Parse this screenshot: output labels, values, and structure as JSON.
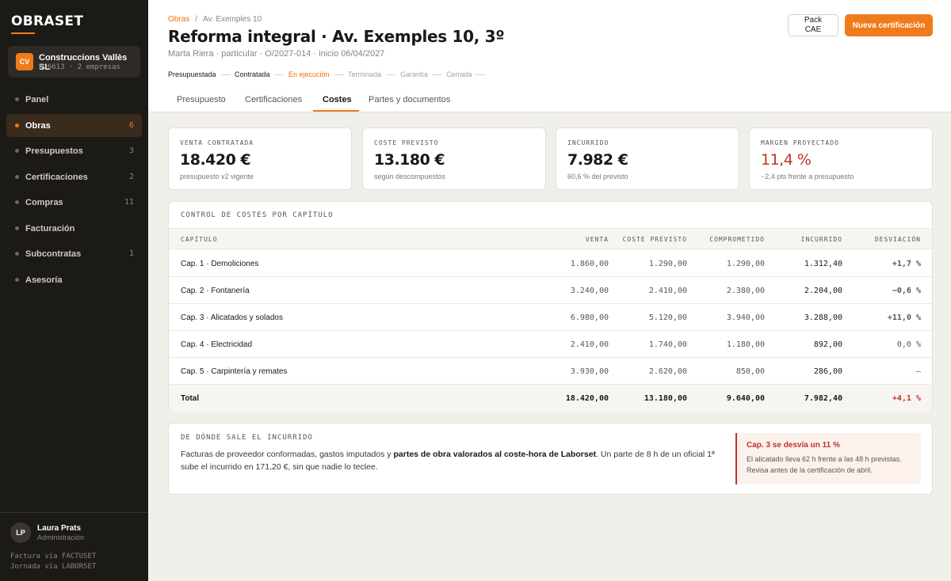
{
  "brand": {
    "logo": "OBRASET",
    "accent": "#f07b1a"
  },
  "company": {
    "initials": "CV",
    "name": "Construccions Vallès SL",
    "sub": "B-6613 · 2 empresas"
  },
  "nav": [
    {
      "label": "Panel",
      "count": ""
    },
    {
      "label": "Obras",
      "count": "6"
    },
    {
      "label": "Presupuestos",
      "count": "3"
    },
    {
      "label": "Certificaciones",
      "count": "2"
    },
    {
      "label": "Compras",
      "count": "11"
    },
    {
      "label": "Facturación",
      "count": ""
    },
    {
      "label": "Subcontratas",
      "count": "1"
    },
    {
      "label": "Asesoría",
      "count": ""
    }
  ],
  "user": {
    "initials": "LP",
    "name": "Laura Prats",
    "role": "Administración",
    "footer1": "Factura vía FACTUSET",
    "footer2": "Jornada vía LABORSET"
  },
  "breadcrumb": {
    "root": "Obras",
    "current": "Av. Exemples 10"
  },
  "project": {
    "title": "Reforma integral · Av. Exemples 10, 3º",
    "meta": "Marta Riera · particular · O/2027-014 · inicio 06/04/2027"
  },
  "actions": {
    "pack_line1": "Pack",
    "pack_line2": "CAE",
    "new_cert": "Nueva certificación"
  },
  "stages": [
    "Presupuestada",
    "Contratada",
    "En ejecución",
    "Terminada",
    "Garantía",
    "Cerrada"
  ],
  "tabs": [
    "Presupuesto",
    "Certificaciones",
    "Costes",
    "Partes y documentos"
  ],
  "kpis": [
    {
      "label": "VENTA CONTRATADA",
      "value": "18.420 €",
      "sub": "presupuesto v2 vigente"
    },
    {
      "label": "COSTE PREVISTO",
      "value": "13.180 €",
      "sub": "según descompuestos"
    },
    {
      "label": "INCURRIDO",
      "value": "7.982 €",
      "sub": "60,6 % del previsto"
    },
    {
      "label": "MARGEN PROYECTADO",
      "value": "11,4 %",
      "sub": "−2,4 pts frente a presupuesto"
    }
  ],
  "cost_table": {
    "title": "CONTROL DE COSTES POR CAPÍTULO",
    "headers": [
      "CAPÍTULO",
      "VENTA",
      "COSTE PREVISTO",
      "COMPROMETIDO",
      "INCURRIDO",
      "DESVIACIÓN"
    ],
    "rows": [
      {
        "name": "Cap. 1 · Demoliciones",
        "venta": "1.860,00",
        "coste": "1.290,00",
        "comprometido": "1.290,00",
        "incurrido": "1.312,40",
        "desviacion": "+1,7 %"
      },
      {
        "name": "Cap. 2 · Fontanería",
        "venta": "3.240,00",
        "coste": "2.410,00",
        "comprometido": "2.380,00",
        "incurrido": "2.204,00",
        "desviacion": "−0,6 %"
      },
      {
        "name": "Cap. 3 · Alicatados y solados",
        "venta": "6.980,00",
        "coste": "5.120,00",
        "comprometido": "3.940,00",
        "incurrido": "3.288,00",
        "desviacion": "+11,0 %"
      },
      {
        "name": "Cap. 4 · Electricidad",
        "venta": "2.410,00",
        "coste": "1.740,00",
        "comprometido": "1.180,00",
        "incurrido": "892,00",
        "desviacion": "0,0 %"
      },
      {
        "name": "Cap. 5 · Carpintería y remates",
        "venta": "3.930,00",
        "coste": "2.620,00",
        "comprometido": "850,00",
        "incurrido": "286,00",
        "desviacion": "—"
      }
    ],
    "total": {
      "name": "Total",
      "venta": "18.420,00",
      "coste": "13.180,00",
      "comprometido": "9.640,00",
      "incurrido": "7.982,40",
      "desviacion": "+4,1 %"
    }
  },
  "source": {
    "title": "DE DÓNDE SALE EL INCURRIDO",
    "text_a": "Facturas de proveedor conformadas, gastos imputados y ",
    "text_bold": "partes de obra valorados al coste-hora de Laborset",
    "text_b": ". Un parte de 8 h de un oficial 1ª sube el incurrido en 171,20 €, sin que nadie lo teclee."
  },
  "alert": {
    "title": "Cap. 3 se desvía un 11 %",
    "body": "El alicatado lleva 62 h frente a las 48 h previstas. Revisa antes de la certificación de abril."
  },
  "colors": {
    "warn": "#d99a12",
    "good": "#2e8a52",
    "bad": "#c0322b"
  }
}
